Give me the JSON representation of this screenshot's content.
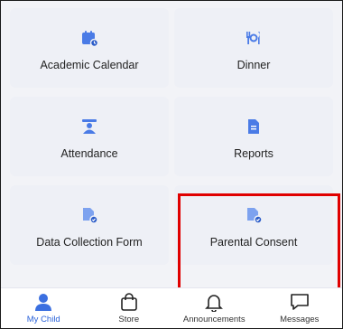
{
  "tiles": [
    {
      "label": "Academic Calendar",
      "icon": "calendar-icon"
    },
    {
      "label": "Dinner",
      "icon": "utensils-icon"
    },
    {
      "label": "Attendance",
      "icon": "teacher-icon"
    },
    {
      "label": "Reports",
      "icon": "report-document-icon"
    },
    {
      "label": "Data Collection Form",
      "icon": "form-document-icon"
    },
    {
      "label": "Parental Consent",
      "icon": "consent-document-icon"
    }
  ],
  "tabs": [
    {
      "label": "My Child",
      "icon": "person-icon",
      "active": true
    },
    {
      "label": "Store",
      "icon": "shopping-bag-icon",
      "active": false
    },
    {
      "label": "Announcements",
      "icon": "bell-icon",
      "active": false
    },
    {
      "label": "Messages",
      "icon": "chat-icon",
      "active": false
    }
  ],
  "colors": {
    "accent": "#3b6fe0",
    "active_tab_text": "#2b63d9",
    "highlight_box": "#e00000",
    "tile_bg": "#eef0f6"
  }
}
